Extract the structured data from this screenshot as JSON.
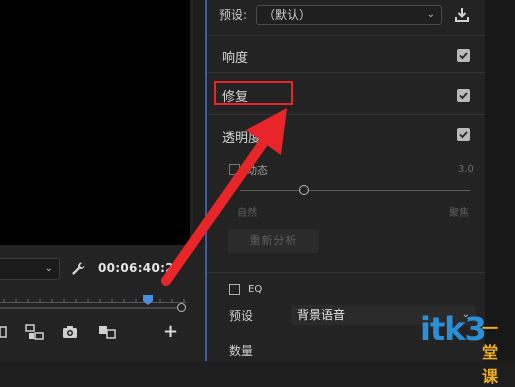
{
  "monitor": {
    "quality_select": "",
    "timecode": "00:06:40:2"
  },
  "panel": {
    "preset_label": "预设:",
    "preset_value": "（默认）",
    "categories": [
      {
        "label": "响度",
        "checked": true
      },
      {
        "label": "修复",
        "checked": true
      },
      {
        "label": "透明度",
        "checked": true
      }
    ],
    "auto": {
      "label": "动态",
      "readout": "3.0",
      "slider_min": "自然",
      "slider_max": "聚焦",
      "value": 0.27
    },
    "reanalyze_label": "重新分析",
    "eq": {
      "label": "EQ",
      "preset_label": "预设",
      "preset_value": "背景语音",
      "amount_label": "数量"
    }
  },
  "watermark": {
    "main": "itk3",
    "sub": "一堂课"
  },
  "colors": {
    "accent_blue": "#3b5da8",
    "annotation_red": "#e8262a",
    "playhead_blue": "#4a8fe0"
  }
}
